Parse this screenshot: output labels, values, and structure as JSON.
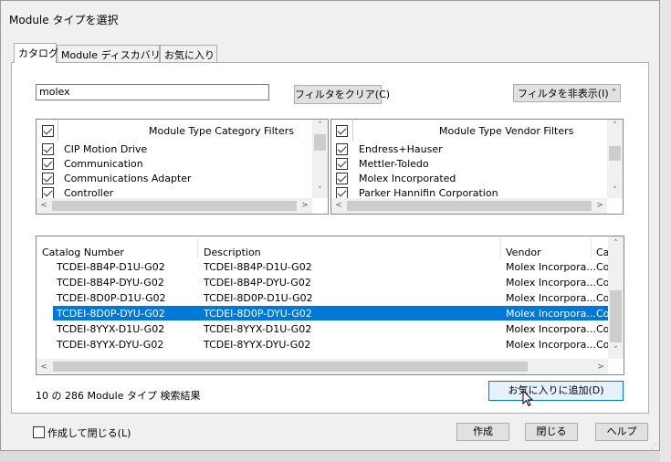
{
  "window": {
    "title": "Module タイプを選択"
  },
  "tabs": [
    {
      "label": "カタログ"
    },
    {
      "label": "Module ディスカバリー"
    },
    {
      "label": "お気に入り"
    }
  ],
  "search": {
    "value": "molex"
  },
  "buttons": {
    "clear_filter": "フィルタをクリア(C)",
    "hide_filter": "フィルタを非表示(I)",
    "add_favorite": "お気に入りに追加(D)",
    "create": "作成",
    "close": "閉じる",
    "help": "ヘルプ"
  },
  "category_filters": {
    "header": "Module Type Category Filters",
    "items": [
      "CIP Motion Drive",
      "Communication",
      "Communications Adapter",
      "Controller"
    ]
  },
  "vendor_filters": {
    "header": "Module Type Vendor Filters",
    "items": [
      "Endress+Hauser",
      "Mettler-Toledo",
      "Molex Incorporated",
      "Parker Hannifin Corporation"
    ]
  },
  "table": {
    "columns": [
      "Catalog Number",
      "Description",
      "Vendor",
      "Ca"
    ],
    "rows": [
      {
        "catalog": "TCDEI-8B4P-D1U-G02",
        "description": "TCDEI-8B4P-D1U-G02",
        "vendor": "Molex Incorpora...",
        "cat": "Co"
      },
      {
        "catalog": "TCDEI-8B4P-DYU-G02",
        "description": "TCDEI-8B4P-DYU-G02",
        "vendor": "Molex Incorpora...",
        "cat": "Co"
      },
      {
        "catalog": "TCDEI-8D0P-D1U-G02",
        "description": "TCDEI-8D0P-D1U-G02",
        "vendor": "Molex Incorpora...",
        "cat": "Co"
      },
      {
        "catalog": "TCDEI-8D0P-DYU-G02",
        "description": "TCDEI-8D0P-DYU-G02",
        "vendor": "Molex Incorpora...",
        "cat": "Co"
      },
      {
        "catalog": "TCDEI-8YYX-D1U-G02",
        "description": "TCDEI-8YYX-D1U-G02",
        "vendor": "Molex Incorpora...",
        "cat": "Co"
      },
      {
        "catalog": "TCDEI-8YYX-DYU-G02",
        "description": "TCDEI-8YYX-DYU-G02",
        "vendor": "Molex Incorpora...",
        "cat": "Co"
      }
    ],
    "selected_index": 3
  },
  "status": {
    "result_text": "10 の 286 Module タイプ 検索結果"
  },
  "footer": {
    "close_after_create": "作成して閉じる(L)"
  },
  "colors": {
    "selection": "#0078d7",
    "button_focus": "#0078d7"
  },
  "icons": {
    "hide_filter": "double-chevron-up-icon",
    "cursor": "mouse-pointer-icon"
  }
}
